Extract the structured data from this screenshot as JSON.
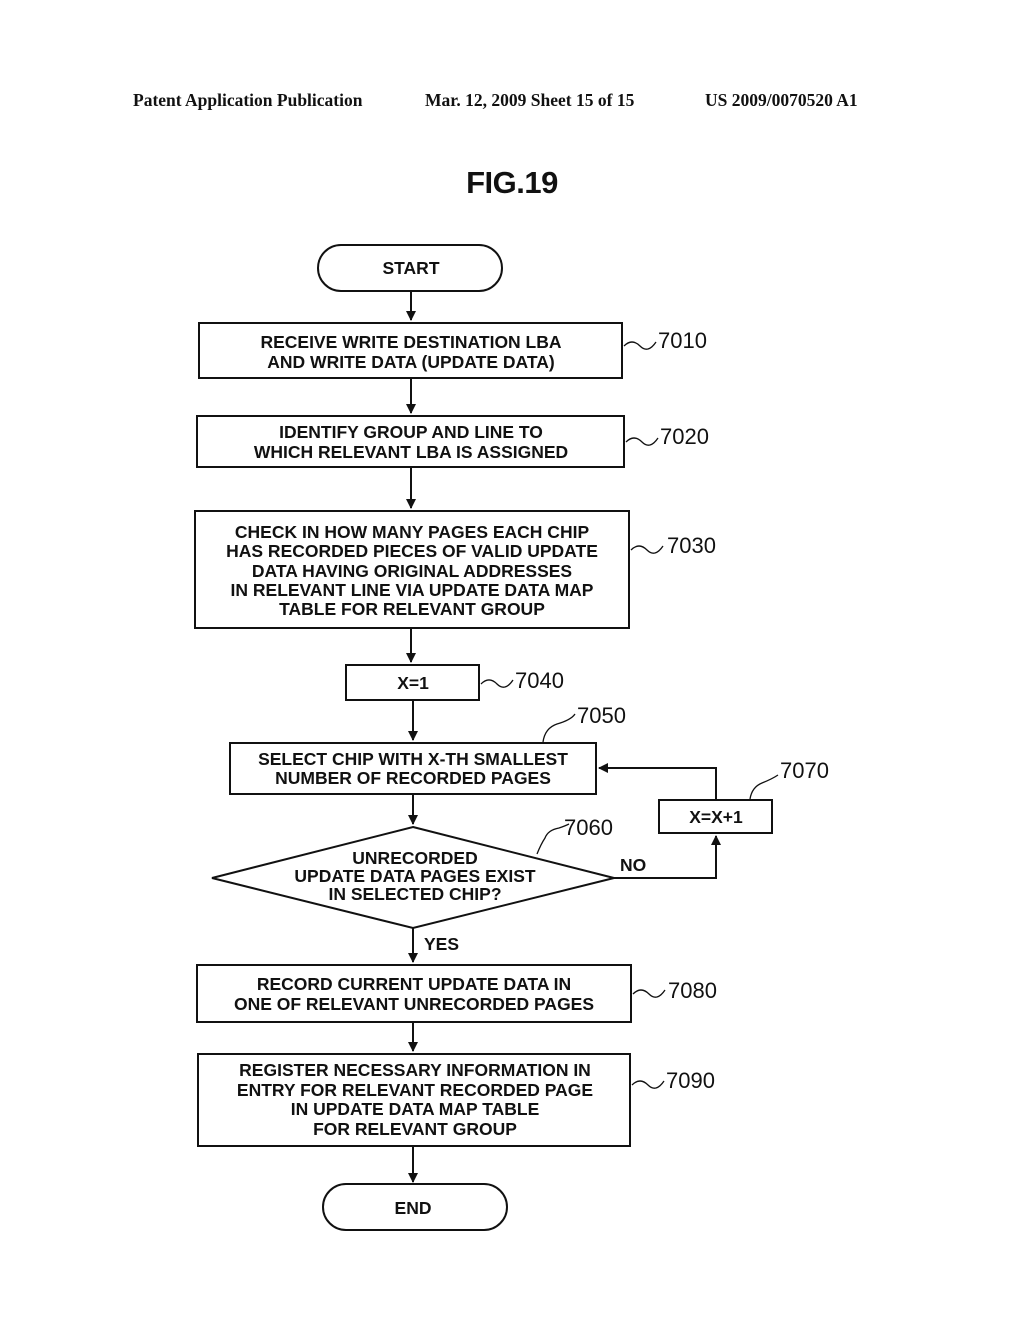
{
  "header": {
    "publication": "Patent Application Publication",
    "date_sheet": "Mar. 12, 2009  Sheet 15 of 15",
    "number": "US 2009/0070520 A1"
  },
  "figure": {
    "title": "FIG.19",
    "start": "START",
    "end": "END",
    "steps": {
      "s7010": {
        "ref": "7010",
        "lines": [
          "RECEIVE WRITE DESTINATION LBA",
          "AND WRITE DATA (UPDATE DATA)"
        ]
      },
      "s7020": {
        "ref": "7020",
        "lines": [
          "IDENTIFY GROUP AND LINE TO",
          "WHICH RELEVANT LBA IS ASSIGNED"
        ]
      },
      "s7030": {
        "ref": "7030",
        "lines": [
          "CHECK IN HOW MANY PAGES EACH CHIP",
          "HAS RECORDED PIECES OF VALID UPDATE",
          "DATA HAVING ORIGINAL ADDRESSES",
          "IN RELEVANT LINE VIA UPDATE DATA MAP",
          "TABLE FOR RELEVANT GROUP"
        ]
      },
      "s7040": {
        "ref": "7040",
        "lines": [
          "X=1"
        ]
      },
      "s7050": {
        "ref": "7050",
        "lines": [
          "SELECT CHIP WITH X-TH SMALLEST",
          "NUMBER OF RECORDED PAGES"
        ]
      },
      "s7060": {
        "ref": "7060",
        "lines": [
          "UNRECORDED",
          "UPDATE DATA PAGES EXIST",
          "IN SELECTED CHIP?"
        ]
      },
      "s7070": {
        "ref": "7070",
        "lines": [
          "X=X+1"
        ]
      },
      "s7080": {
        "ref": "7080",
        "lines": [
          "RECORD CURRENT UPDATE DATA IN",
          "ONE OF RELEVANT UNRECORDED PAGES"
        ]
      },
      "s7090": {
        "ref": "7090",
        "lines": [
          "REGISTER NECESSARY INFORMATION IN",
          "ENTRY FOR RELEVANT RECORDED PAGE",
          "IN UPDATE DATA MAP TABLE",
          "FOR RELEVANT GROUP"
        ]
      }
    },
    "branch_labels": {
      "yes": "YES",
      "no": "NO"
    }
  }
}
